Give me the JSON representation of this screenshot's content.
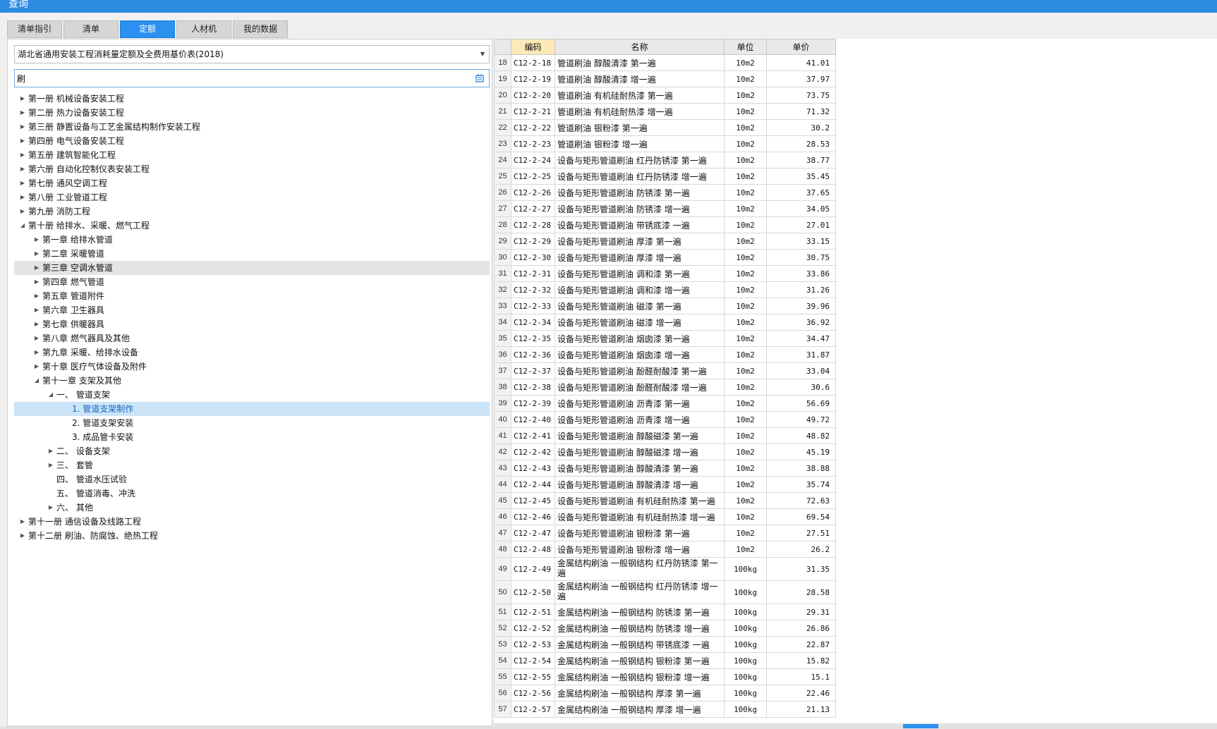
{
  "window": {
    "title": "查询"
  },
  "tabs": [
    {
      "label": "清单指引",
      "active": false
    },
    {
      "label": "清单",
      "active": false
    },
    {
      "label": "定额",
      "active": true
    },
    {
      "label": "人材机",
      "active": false
    },
    {
      "label": "我的数据",
      "active": false
    }
  ],
  "library_select": {
    "value": "湖北省通用安装工程消耗量定额及全费用基价表(2018)"
  },
  "search": {
    "value": "刷",
    "icon": "search-icon"
  },
  "tree": [
    {
      "label": "第一册 机械设备安装工程",
      "level": 0,
      "state": "collapsed"
    },
    {
      "label": "第二册 热力设备安装工程",
      "level": 0,
      "state": "collapsed"
    },
    {
      "label": "第三册 静置设备与工艺金属结构制作安装工程",
      "level": 0,
      "state": "collapsed"
    },
    {
      "label": "第四册 电气设备安装工程",
      "level": 0,
      "state": "collapsed"
    },
    {
      "label": "第五册 建筑智能化工程",
      "level": 0,
      "state": "collapsed"
    },
    {
      "label": "第六册 自动化控制仪表安装工程",
      "level": 0,
      "state": "collapsed"
    },
    {
      "label": "第七册 通风空调工程",
      "level": 0,
      "state": "collapsed"
    },
    {
      "label": "第八册 工业管道工程",
      "level": 0,
      "state": "collapsed"
    },
    {
      "label": "第九册 消防工程",
      "level": 0,
      "state": "collapsed"
    },
    {
      "label": "第十册 给排水、采暖、燃气工程",
      "level": 0,
      "state": "expanded"
    },
    {
      "label": "第一章 给排水管道",
      "level": 1,
      "state": "collapsed"
    },
    {
      "label": "第二章 采暖管道",
      "level": 1,
      "state": "collapsed"
    },
    {
      "label": "第三章 空调水管道",
      "level": 1,
      "state": "collapsed",
      "hover": true
    },
    {
      "label": "第四章 燃气管道",
      "level": 1,
      "state": "collapsed"
    },
    {
      "label": "第五章 管道附件",
      "level": 1,
      "state": "collapsed"
    },
    {
      "label": "第六章 卫生器具",
      "level": 1,
      "state": "collapsed"
    },
    {
      "label": "第七章 供暖器具",
      "level": 1,
      "state": "collapsed"
    },
    {
      "label": "第八章 燃气器具及其他",
      "level": 1,
      "state": "collapsed"
    },
    {
      "label": "第九章 采暖、给排水设备",
      "level": 1,
      "state": "collapsed"
    },
    {
      "label": "第十章 医疗气体设备及附件",
      "level": 1,
      "state": "collapsed"
    },
    {
      "label": "第十一章 支架及其他",
      "level": 1,
      "state": "expanded"
    },
    {
      "label": "一、 管道支架",
      "level": 2,
      "state": "expanded"
    },
    {
      "label": "1. 管道支架制作",
      "level": 3,
      "state": "leaf",
      "selected": true
    },
    {
      "label": "2. 管道支架安装",
      "level": 3,
      "state": "leaf"
    },
    {
      "label": "3. 成品管卡安装",
      "level": 3,
      "state": "leaf"
    },
    {
      "label": "二、 设备支架",
      "level": 2,
      "state": "collapsed"
    },
    {
      "label": "三、 套管",
      "level": 2,
      "state": "collapsed"
    },
    {
      "label": "四、 管道水压试验",
      "level": 2,
      "state": "leaf"
    },
    {
      "label": "五、 管道消毒、冲洗",
      "level": 2,
      "state": "leaf"
    },
    {
      "label": "六、 其他",
      "level": 2,
      "state": "collapsed"
    },
    {
      "label": "第十一册 通信设备及线路工程",
      "level": 0,
      "state": "collapsed"
    },
    {
      "label": "第十二册 刷油、防腐蚀、绝热工程",
      "level": 0,
      "state": "collapsed"
    }
  ],
  "grid": {
    "columns": {
      "code": "编码",
      "name": "名称",
      "unit": "单位",
      "price": "单价"
    },
    "rows": [
      [
        "18",
        "C12-2-18",
        "管道刷油 醇酸清漆 第一遍",
        "10m2",
        "41.01"
      ],
      [
        "19",
        "C12-2-19",
        "管道刷油 醇酸清漆 增一遍",
        "10m2",
        "37.97"
      ],
      [
        "20",
        "C12-2-20",
        "管道刷油 有机硅耐热漆 第一遍",
        "10m2",
        "73.75"
      ],
      [
        "21",
        "C12-2-21",
        "管道刷油 有机硅耐热漆 增一遍",
        "10m2",
        "71.32"
      ],
      [
        "22",
        "C12-2-22",
        "管道刷油 银粉漆 第一遍",
        "10m2",
        "30.2"
      ],
      [
        "23",
        "C12-2-23",
        "管道刷油 银粉漆 增一遍",
        "10m2",
        "28.53"
      ],
      [
        "24",
        "C12-2-24",
        "设备与矩形管道刷油 红丹防锈漆 第一遍",
        "10m2",
        "38.77"
      ],
      [
        "25",
        "C12-2-25",
        "设备与矩形管道刷油 红丹防锈漆 增一遍",
        "10m2",
        "35.45"
      ],
      [
        "26",
        "C12-2-26",
        "设备与矩形管道刷油 防锈漆 第一遍",
        "10m2",
        "37.65"
      ],
      [
        "27",
        "C12-2-27",
        "设备与矩形管道刷油 防锈漆 增一遍",
        "10m2",
        "34.05"
      ],
      [
        "28",
        "C12-2-28",
        "设备与矩形管道刷油 带锈底漆 一遍",
        "10m2",
        "27.01"
      ],
      [
        "29",
        "C12-2-29",
        "设备与矩形管道刷油 厚漆 第一遍",
        "10m2",
        "33.15"
      ],
      [
        "30",
        "C12-2-30",
        "设备与矩形管道刷油 厚漆 增一遍",
        "10m2",
        "30.75"
      ],
      [
        "31",
        "C12-2-31",
        "设备与矩形管道刷油 调和漆 第一遍",
        "10m2",
        "33.86"
      ],
      [
        "32",
        "C12-2-32",
        "设备与矩形管道刷油 调和漆 增一遍",
        "10m2",
        "31.26"
      ],
      [
        "33",
        "C12-2-33",
        "设备与矩形管道刷油 磁漆 第一遍",
        "10m2",
        "39.96"
      ],
      [
        "34",
        "C12-2-34",
        "设备与矩形管道刷油 磁漆 增一遍",
        "10m2",
        "36.92"
      ],
      [
        "35",
        "C12-2-35",
        "设备与矩形管道刷油 烟囱漆 第一遍",
        "10m2",
        "34.47"
      ],
      [
        "36",
        "C12-2-36",
        "设备与矩形管道刷油 烟囱漆 增一遍",
        "10m2",
        "31.87"
      ],
      [
        "37",
        "C12-2-37",
        "设备与矩形管道刷油 酚醛耐酸漆 第一遍",
        "10m2",
        "33.04"
      ],
      [
        "38",
        "C12-2-38",
        "设备与矩形管道刷油 酚醛耐酸漆 增一遍",
        "10m2",
        "30.6"
      ],
      [
        "39",
        "C12-2-39",
        "设备与矩形管道刷油 沥青漆 第一遍",
        "10m2",
        "56.69"
      ],
      [
        "40",
        "C12-2-40",
        "设备与矩形管道刷油 沥青漆 增一遍",
        "10m2",
        "49.72"
      ],
      [
        "41",
        "C12-2-41",
        "设备与矩形管道刷油 醇酸磁漆 第一遍",
        "10m2",
        "48.82"
      ],
      [
        "42",
        "C12-2-42",
        "设备与矩形管道刷油 醇酸磁漆 增一遍",
        "10m2",
        "45.19"
      ],
      [
        "43",
        "C12-2-43",
        "设备与矩形管道刷油 醇酸清漆 第一遍",
        "10m2",
        "38.88"
      ],
      [
        "44",
        "C12-2-44",
        "设备与矩形管道刷油 醇酸清漆 增一遍",
        "10m2",
        "35.74"
      ],
      [
        "45",
        "C12-2-45",
        "设备与矩形管道刷油 有机硅耐热漆 第一遍",
        "10m2",
        "72.63"
      ],
      [
        "46",
        "C12-2-46",
        "设备与矩形管道刷油 有机硅耐热漆 增一遍",
        "10m2",
        "69.54"
      ],
      [
        "47",
        "C12-2-47",
        "设备与矩形管道刷油 银粉漆 第一遍",
        "10m2",
        "27.51"
      ],
      [
        "48",
        "C12-2-48",
        "设备与矩形管道刷油 银粉漆 增一遍",
        "10m2",
        "26.2"
      ],
      [
        "49",
        "C12-2-49",
        "金属结构刷油 一般钢结构 红丹防锈漆 第一遍",
        "100kg",
        "31.35"
      ],
      [
        "50",
        "C12-2-50",
        "金属结构刷油 一般钢结构 红丹防锈漆 增一遍",
        "100kg",
        "28.58"
      ],
      [
        "51",
        "C12-2-51",
        "金属结构刷油 一般钢结构 防锈漆 第一遍",
        "100kg",
        "29.31"
      ],
      [
        "52",
        "C12-2-52",
        "金属结构刷油 一般钢结构 防锈漆 增一遍",
        "100kg",
        "26.86"
      ],
      [
        "53",
        "C12-2-53",
        "金属结构刷油 一般钢结构 带锈底漆 一遍",
        "100kg",
        "22.87"
      ],
      [
        "54",
        "C12-2-54",
        "金属结构刷油 一般钢结构 银粉漆 第一遍",
        "100kg",
        "15.82"
      ],
      [
        "55",
        "C12-2-55",
        "金属结构刷油 一般钢结构 银粉漆 增一遍",
        "100kg",
        "15.1"
      ],
      [
        "56",
        "C12-2-56",
        "金属结构刷油 一般钢结构 厚漆 第一遍",
        "100kg",
        "22.46"
      ],
      [
        "57",
        "C12-2-57",
        "金属结构刷油 一般钢结构 厚漆 增一遍",
        "100kg",
        "21.13"
      ]
    ]
  }
}
